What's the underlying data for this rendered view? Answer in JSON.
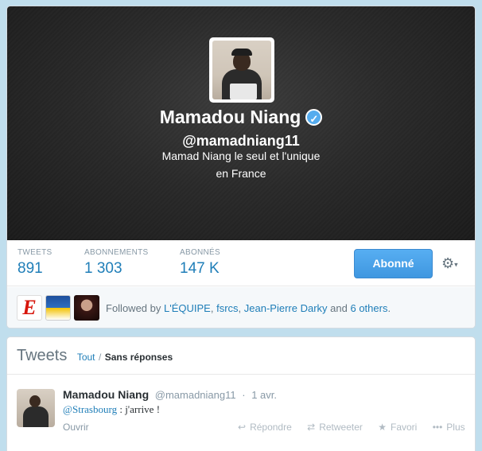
{
  "profile": {
    "name": "Mamadou Niang",
    "verified_icon": "✓",
    "handle": "@mamadniang11",
    "bio": "Mamad Niang le seul et l'unique",
    "location": "en France"
  },
  "stats": [
    {
      "label": "TWEETS",
      "value": "891"
    },
    {
      "label": "ABONNEMENTS",
      "value": "1 303"
    },
    {
      "label": "ABONNÉS",
      "value": "147 K"
    }
  ],
  "actions": {
    "follow_label": "Abonné",
    "gear_icon": "⚙",
    "caret_icon": "▾"
  },
  "followed_by": {
    "prefix": "Followed by",
    "users": [
      "L'ÉQUIPE",
      "fsrcs",
      "Jean-Pierre Darky"
    ],
    "and": "and",
    "others": "6 others",
    "suffix": ".",
    "equipe_logo": "E"
  },
  "tweets_section": {
    "title": "Tweets",
    "tab_all": "Tout",
    "separator": "/",
    "tab_no_replies": "Sans réponses"
  },
  "tweet": {
    "name": "Mamadou Niang",
    "handle": "@mamadniang11",
    "dot": "·",
    "time": "1 avr.",
    "mention": "@Strasbourg",
    "text": " : j'arrive !",
    "open": "Ouvrir",
    "reply": "Répondre",
    "retweet": "Retweeter",
    "favorite": "Favori",
    "more": "Plus",
    "reply_icon": "↩",
    "retweet_icon": "⇄",
    "favorite_icon": "★",
    "more_icon": "•••"
  },
  "colors": {
    "link": "#1f7eb8",
    "follow_button": "#4ea3ea",
    "page_background": "#c0deed"
  }
}
